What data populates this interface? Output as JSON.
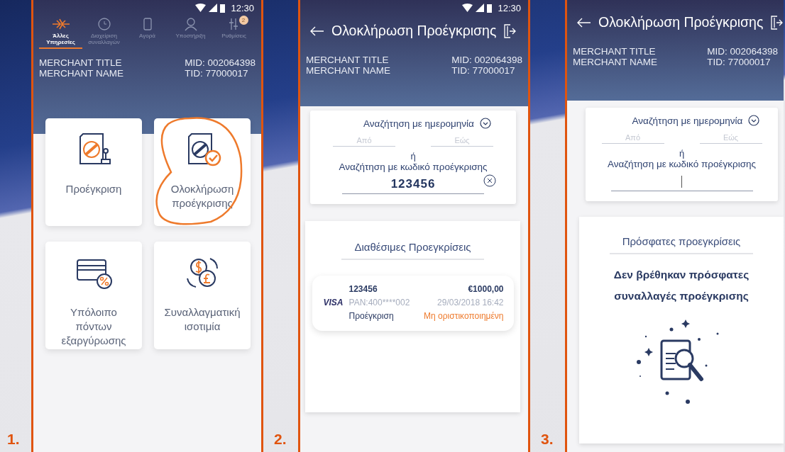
{
  "screens": [
    {
      "kind": "home",
      "number": "1.",
      "status_time": "12:30",
      "tabs": [
        {
          "label": "Άλλες Υπηρεσίες",
          "selected": true
        },
        {
          "label": "Διαχείριση συναλλαγών",
          "selected": false
        },
        {
          "label": "Αγορά",
          "selected": false
        },
        {
          "label": "Υποστήριξη",
          "selected": false
        },
        {
          "label": "Ρυθμίσεις",
          "selected": false,
          "badge": "2"
        }
      ],
      "merchant": {
        "title": "MERCHANT TITLE",
        "name": "MERCHANT NAME",
        "mid": "MID: 002064398",
        "tid": "TID: 77000017"
      },
      "tiles": [
        {
          "label": "Προέγκριση",
          "circled": false
        },
        {
          "label": "Ολοκλήρωση προέγκρισης",
          "circled": true
        },
        {
          "label": "Υπόλοιπο πόντων εξαργύρωσης",
          "circled": false
        },
        {
          "label": "Συναλλαγματική ισοτιμία",
          "circled": false
        }
      ]
    },
    {
      "kind": "search",
      "number": "2.",
      "status_time": "12:30",
      "title": "Ολοκλήρωση Προέγκρισης",
      "merchant": {
        "title": "MERCHANT TITLE",
        "name": "MERCHANT NAME",
        "mid": "MID: 002064398",
        "tid": "TID: 77000017"
      },
      "search": {
        "date_label": "Αναζήτηση με ημερομηνία",
        "from_placeholder": "Από",
        "to_placeholder": "Εώς",
        "or": "ή",
        "code_label": "Αναζήτηση με κωδικό προέγκρισης",
        "code_value": "123456",
        "code_focused": false
      },
      "list": {
        "title": "Διαθέσιμες Προεγκρίσεις",
        "items": [
          {
            "brand": "VISA",
            "code": "123456",
            "amount": "€1000,00",
            "pan": "PAN:400****002",
            "date": "29/03/2018 16:42",
            "type": "Προέγκριση",
            "status": "Μη οριστικοποιημένη"
          }
        ]
      }
    },
    {
      "kind": "search",
      "number": "3.",
      "title": "Ολοκλήρωση Προέγκρισης",
      "merchant": {
        "title": "MERCHANT TITLE",
        "name": "MERCHANT NAME",
        "mid": "MID: 002064398",
        "tid": "TID: 77000017"
      },
      "search": {
        "date_label": "Αναζήτηση με ημερομηνία",
        "from_placeholder": "Από",
        "to_placeholder": "Εώς",
        "or": "ή",
        "code_label": "Αναζήτηση με κωδικό προέγκρισης",
        "code_focused": true
      },
      "recent": {
        "title": "Πρόσφατες προεγκρίσεις",
        "empty_message": "Δεν βρέθηκαν πρόσφατες συναλλαγές προέγκρισης"
      }
    }
  ]
}
